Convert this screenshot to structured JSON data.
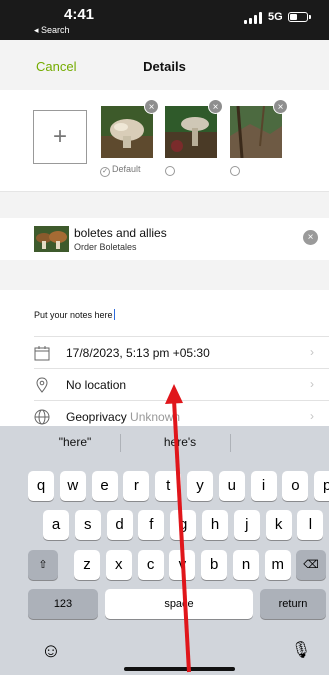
{
  "status_bar": {
    "time": "4:41",
    "back_label": "◂ Search",
    "network": "5G",
    "battery_level": 0.45
  },
  "nav": {
    "cancel_label": "Cancel",
    "title": "Details"
  },
  "photos": {
    "add_symbol": "+",
    "default_label": "Default",
    "remove_symbol": "×"
  },
  "taxon": {
    "name": "boletes and allies",
    "rank": "Order Boletales",
    "clear_symbol": "×"
  },
  "notes": {
    "text": "Put your notes here"
  },
  "rows": {
    "datetime": "17/8/2023, 5:13 pm +05:30",
    "location": "No location",
    "geoprivacy_label": "Geoprivacy",
    "geoprivacy_value": "Unknown",
    "chevron": "›"
  },
  "keyboard": {
    "suggestions": [
      "\"here\"",
      "here's",
      ""
    ],
    "row1": [
      "q",
      "w",
      "e",
      "r",
      "t",
      "y",
      "u",
      "i",
      "o",
      "p"
    ],
    "row2": [
      "a",
      "s",
      "d",
      "f",
      "g",
      "h",
      "j",
      "k",
      "l"
    ],
    "row3": [
      "z",
      "x",
      "c",
      "v",
      "b",
      "n",
      "m"
    ],
    "shift_symbol": "⇧",
    "delete_symbol": "⌫",
    "numbers_label": "123",
    "space_label": "space",
    "return_label": "return",
    "emoji_symbol": "☺",
    "mic_symbol": "🎙"
  },
  "colors": {
    "accent": "#74ac00",
    "annotation": "#e0161b"
  }
}
